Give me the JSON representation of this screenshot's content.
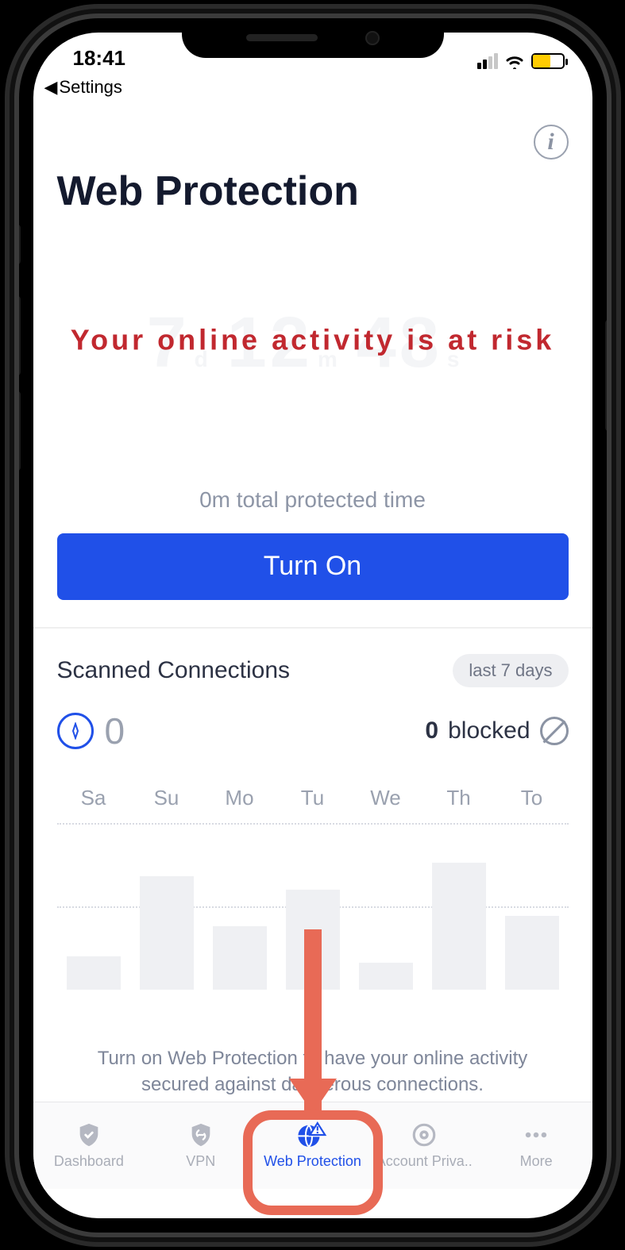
{
  "statusbar": {
    "time": "18:41",
    "back_label": "Settings"
  },
  "header": {
    "title": "Web Protection"
  },
  "ghost_clock": {
    "d_val": "7",
    "d_unit": "d",
    "m_val": "12",
    "m_unit": "m",
    "s_val": "48",
    "s_unit": "s"
  },
  "risk_message": "Your online activity is at risk",
  "protected_time": "0m total protected time",
  "turn_on_label": "Turn On",
  "scanned": {
    "title": "Scanned Connections",
    "range": "last 7 days",
    "total": "0",
    "blocked_count": "0",
    "blocked_label": "blocked"
  },
  "chart_data": {
    "type": "bar",
    "categories": [
      "Sa",
      "Su",
      "Mo",
      "Tu",
      "We",
      "Th",
      "To"
    ],
    "values": [
      20,
      68,
      38,
      60,
      16,
      76,
      44
    ],
    "title": "Scanned Connections — last 7 days",
    "xlabel": "",
    "ylabel": "",
    "ylim": [
      0,
      100
    ]
  },
  "hint": "Turn on Web Protection to have your online activity secured against dangerous connections.",
  "tabs": {
    "dashboard": "Dashboard",
    "vpn": "VPN",
    "web_protection": "Web Protection",
    "account_privacy": "Account Priva..",
    "more": "More"
  }
}
